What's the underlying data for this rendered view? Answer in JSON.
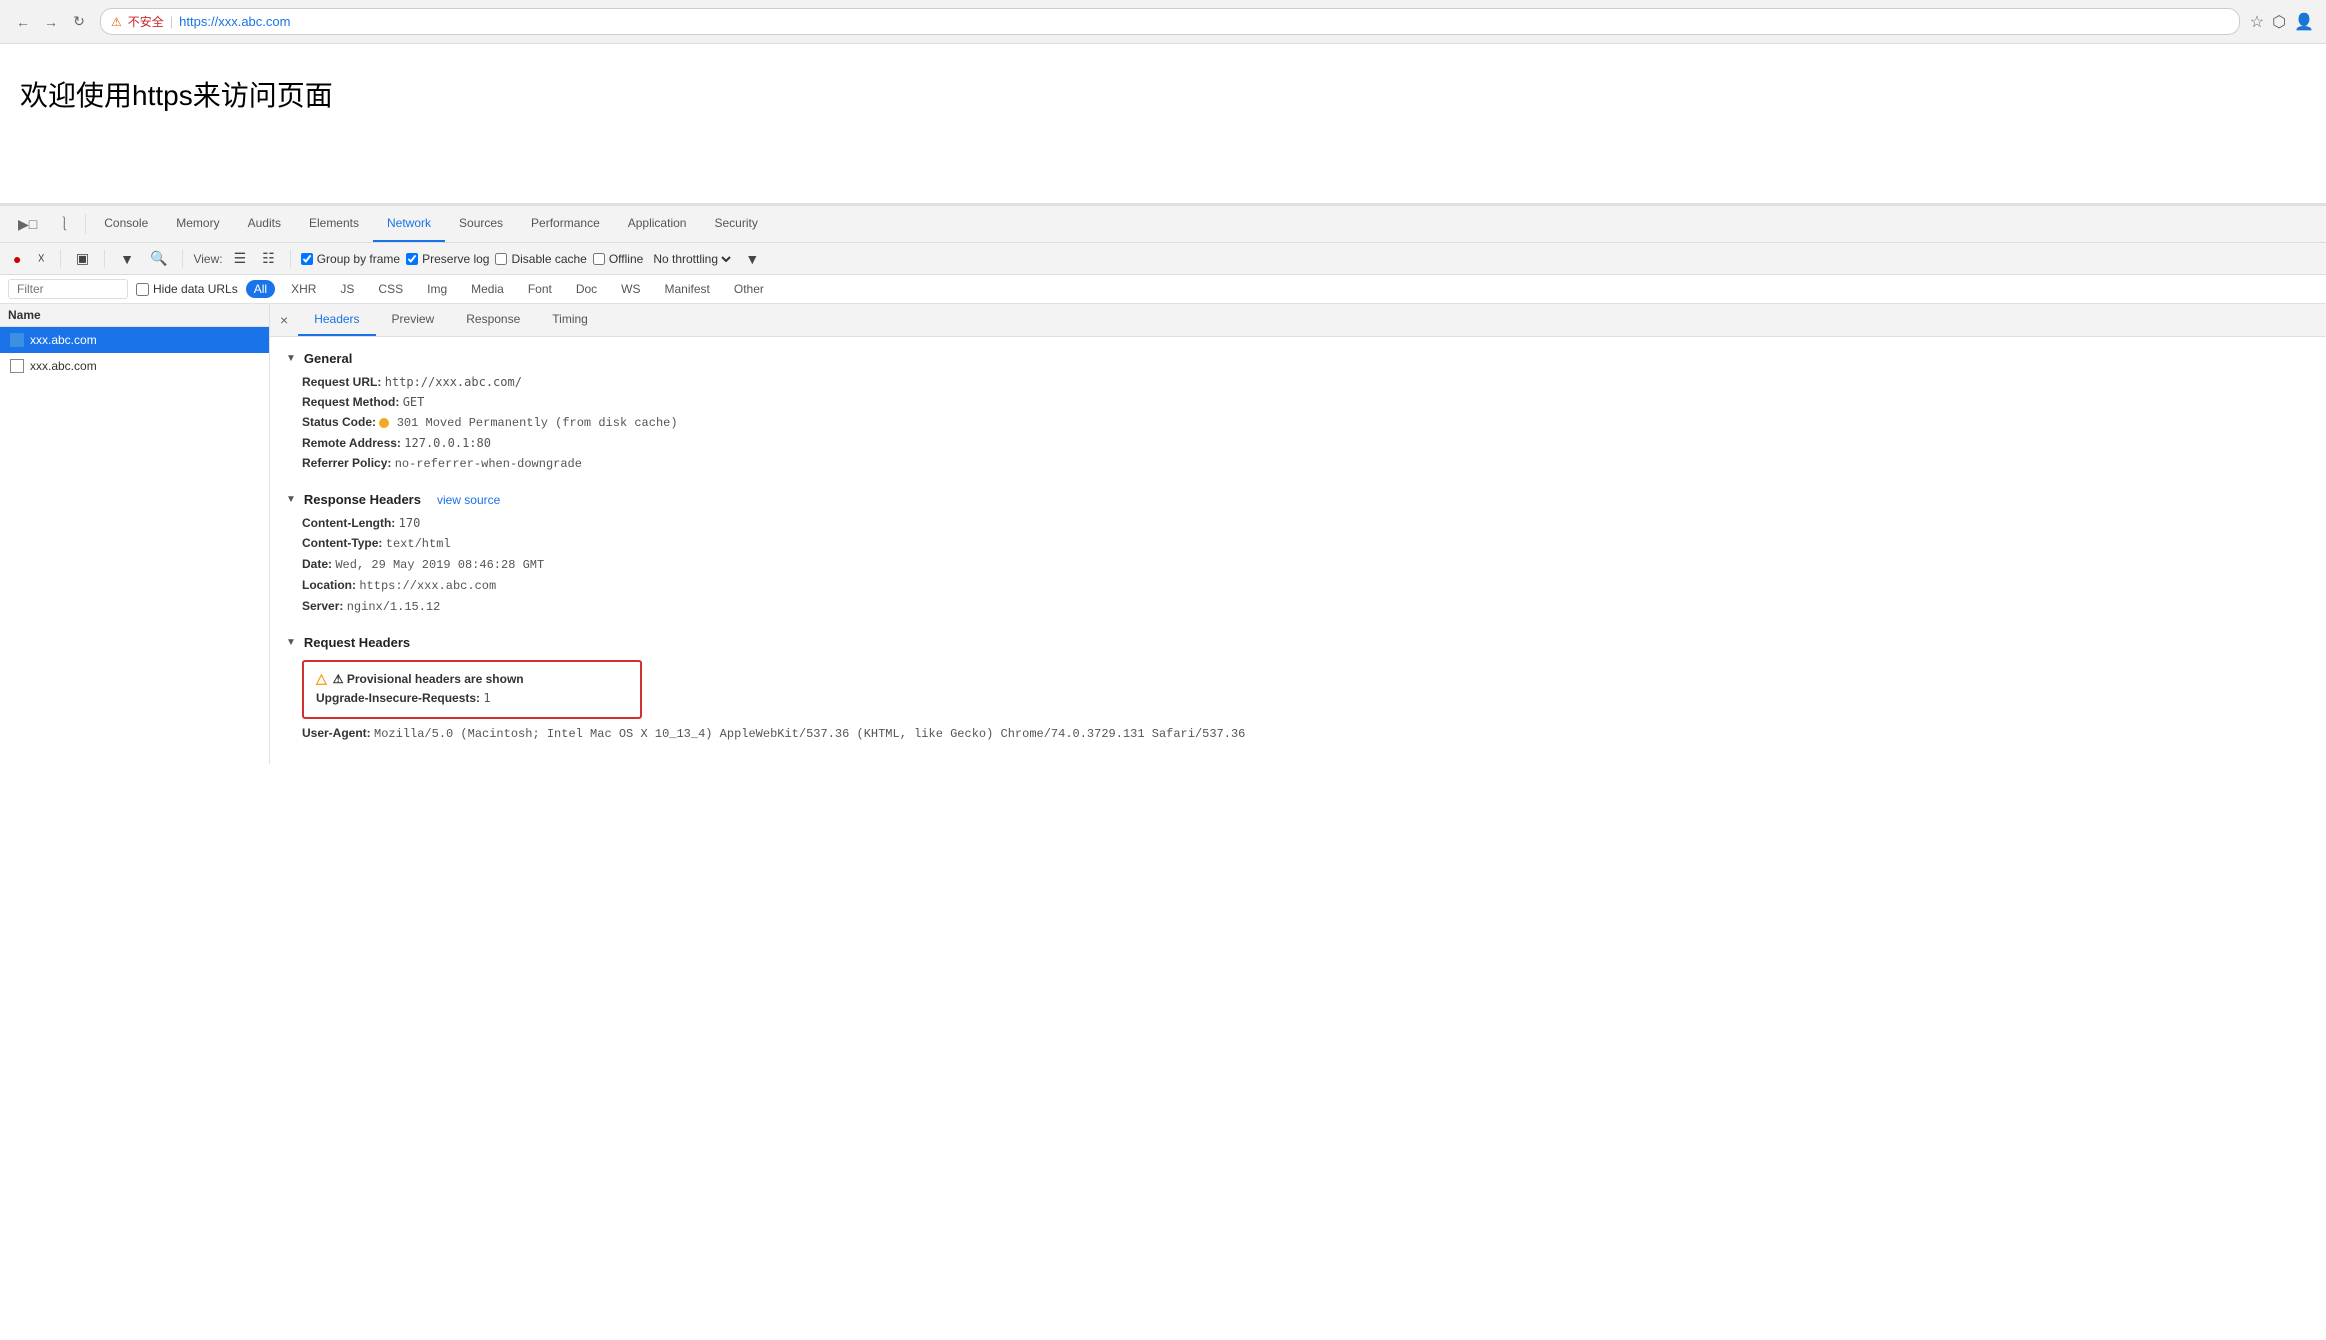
{
  "browser": {
    "back_disabled": true,
    "forward_disabled": true,
    "warning_label": "不安全",
    "url_prefix": "https://",
    "url_domain": "xxx.abc.com",
    "bookmark_icon": "☆",
    "menu_icon": "⋮"
  },
  "page": {
    "title": "欢迎使用https来访问页面"
  },
  "devtools": {
    "tabs": [
      {
        "label": "Console",
        "active": false
      },
      {
        "label": "Memory",
        "active": false
      },
      {
        "label": "Audits",
        "active": false
      },
      {
        "label": "Elements",
        "active": false
      },
      {
        "label": "Network",
        "active": true
      },
      {
        "label": "Sources",
        "active": false
      },
      {
        "label": "Performance",
        "active": false
      },
      {
        "label": "Application",
        "active": false
      },
      {
        "label": "Security",
        "active": false
      }
    ],
    "toolbar": {
      "view_label": "View:",
      "group_by_frame_label": "Group by frame",
      "group_by_frame_checked": true,
      "preserve_log_label": "Preserve log",
      "preserve_log_checked": true,
      "disable_cache_label": "Disable cache",
      "disable_cache_checked": false,
      "offline_label": "Offline",
      "offline_checked": false,
      "no_throttling_label": "No throttling"
    },
    "filter_bar": {
      "placeholder": "Filter",
      "hide_data_urls_label": "Hide data URLs",
      "types": [
        "All",
        "XHR",
        "JS",
        "CSS",
        "Img",
        "Media",
        "Font",
        "Doc",
        "WS",
        "Manifest",
        "Other"
      ],
      "active_type": "All"
    },
    "request_list": {
      "header": "Name",
      "items": [
        {
          "name": "xxx.abc.com",
          "selected": true
        },
        {
          "name": "xxx.abc.com",
          "selected": false
        }
      ]
    },
    "detail": {
      "tabs": [
        "Headers",
        "Preview",
        "Response",
        "Timing"
      ],
      "active_tab": "Headers",
      "general": {
        "section_label": "General",
        "request_url_label": "Request URL:",
        "request_url_value": "http://xxx.abc.com/",
        "request_method_label": "Request Method:",
        "request_method_value": "GET",
        "status_code_label": "Status Code:",
        "status_code_value": "301 Moved Permanently (from disk cache)",
        "remote_address_label": "Remote Address:",
        "remote_address_value": "127.0.0.1:80",
        "referrer_policy_label": "Referrer Policy:",
        "referrer_policy_value": "no-referrer-when-downgrade"
      },
      "response_headers": {
        "section_label": "Response Headers",
        "view_source_label": "view source",
        "items": [
          {
            "key": "Content-Length:",
            "value": "170"
          },
          {
            "key": "Content-Type:",
            "value": "text/html"
          },
          {
            "key": "Date:",
            "value": "Wed, 29 May 2019 08:46:28 GMT"
          },
          {
            "key": "Location:",
            "value": "https://xxx.abc.com"
          },
          {
            "key": "Server:",
            "value": "nginx/1.15.12"
          }
        ]
      },
      "request_headers": {
        "section_label": "Request Headers",
        "provisional_warning": "⚠ Provisional headers are shown",
        "items": [
          {
            "key": "Upgrade-Insecure-Requests:",
            "value": "1"
          },
          {
            "key": "User-Agent:",
            "value": "Mozilla/5.0 (Macintosh; Intel Mac OS X 10_13_4) AppleWebKit/537.36 (KHTML, like Gecko) Chrome/74.0.3729.131 Safari/537.36"
          }
        ]
      }
    }
  }
}
